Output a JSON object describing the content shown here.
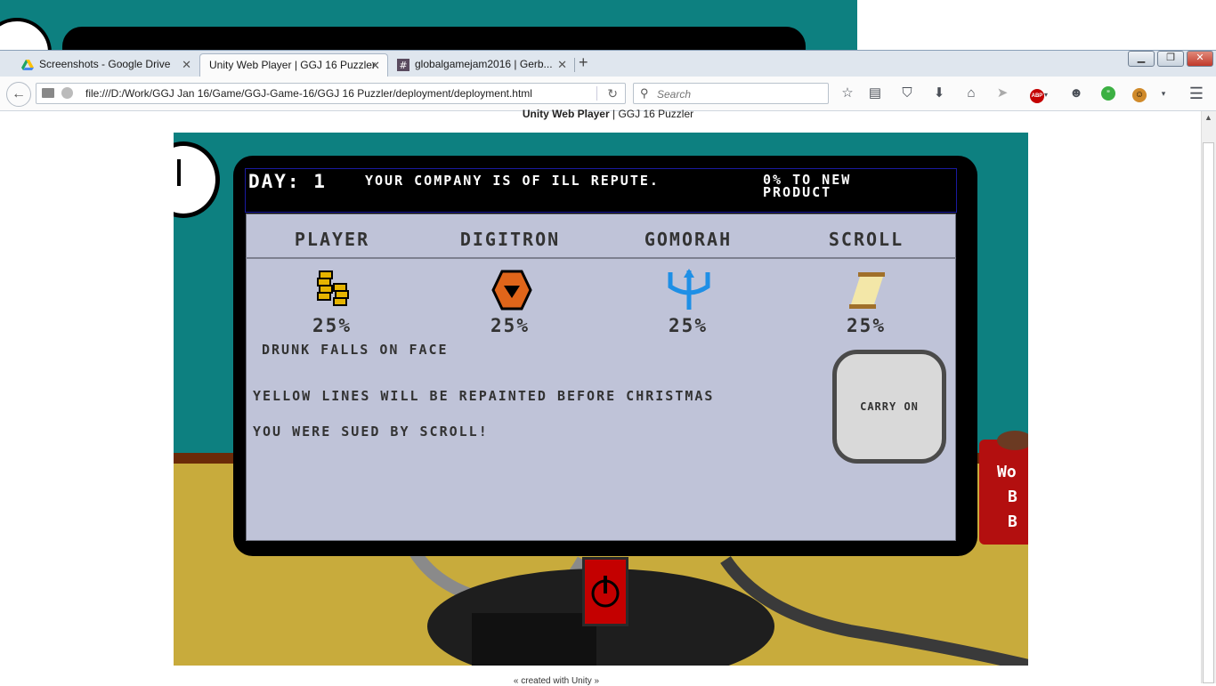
{
  "browser": {
    "tabs": [
      {
        "label": "Screenshots - Google Drive",
        "active": false
      },
      {
        "label": "Unity Web Player | GGJ 16 Puzzler",
        "active": true
      },
      {
        "label": "globalgamejam2016 | Gerb...",
        "active": false
      }
    ],
    "url": "file:///D:/Work/GGJ Jan 16/Game/GGJ-Game-16/GGJ 16 Puzzler/deployment/deployment.html",
    "search_placeholder": "Search",
    "new_tab_icon": "plus-icon",
    "window_controls": [
      "minimize",
      "restore",
      "close"
    ]
  },
  "page": {
    "title_bold": "Unity Web Player",
    "title_rest": " | GGJ 16 Puzzler",
    "footer": "« created with Unity »"
  },
  "game": {
    "header": {
      "day": "DAY: 1",
      "reputation": "YOUR COMPANY IS OF ILL REPUTE.",
      "progress": "0% TO NEW PRODUCT"
    },
    "companies": [
      {
        "name": "PLAYER",
        "share": "25%",
        "icon": "coins-icon"
      },
      {
        "name": "DIGITRON",
        "share": "25%",
        "icon": "hexagon-icon"
      },
      {
        "name": "GOMORAH",
        "share": "25%",
        "icon": "trident-icon"
      },
      {
        "name": "SCROLL",
        "share": "25%",
        "icon": "scroll-icon"
      }
    ],
    "player_event": "DRUNK FALLS ON FACE",
    "news": [
      "YELLOW LINES WILL BE REPAINTED BEFORE CHRISTMAS",
      "YOU WERE SUED BY SCROLL!"
    ],
    "button": "CARRY ON",
    "mug_text": [
      "Wo",
      "B",
      "B"
    ]
  }
}
